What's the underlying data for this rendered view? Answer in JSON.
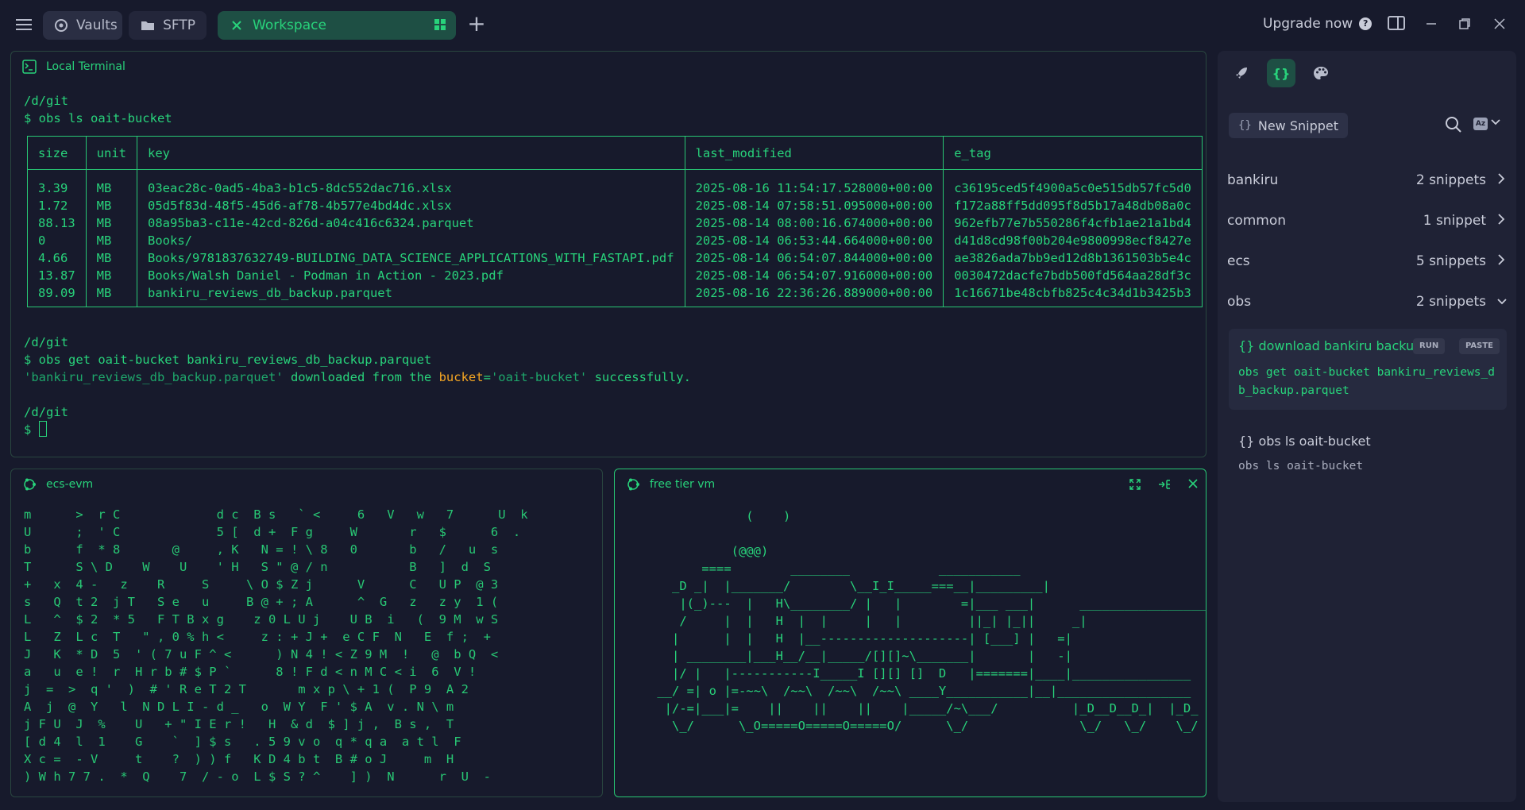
{
  "topbar": {
    "tabs": [
      {
        "label": "Vaults",
        "icon": "vault-icon"
      },
      {
        "label": "SFTP",
        "icon": "folder-icon"
      },
      {
        "label": "Workspace",
        "icon": "workspace-icon"
      }
    ],
    "upgrade_label": "Upgrade now",
    "accent": "#28d37b"
  },
  "main_terminal": {
    "title": "Local Terminal",
    "lines": {
      "cwd1": "/d/git",
      "cmd1": "$ obs ls oait-bucket",
      "cwd2": "/d/git",
      "cmd2": "$ obs get oait-bucket bankiru_reviews_db_backup.parquet",
      "out_q1": "'bankiru_reviews_db_backup.parquet'",
      "out_mid": " downloaded from the ",
      "out_bucket": "bucket",
      "out_eq": "=",
      "out_q2": "'oait-bucket'",
      "out_end": " successfully.",
      "cwd3": "/d/git",
      "prompt": "$ "
    },
    "table": {
      "headers": [
        "size",
        "unit",
        "key",
        "last_modified",
        "e_tag"
      ],
      "rows": [
        [
          "3.39",
          "MB",
          "03eac28c-0ad5-4ba3-b1c5-8dc552dac716.xlsx",
          "2025-08-16 11:54:17.528000+00:00",
          "c36195ced5f4900a5c0e515db57fc5d0"
        ],
        [
          "1.72",
          "MB",
          "05d5f83d-48f5-45d6-af78-4b577e4bd4dc.xlsx",
          "2025-08-14 07:58:51.095000+00:00",
          "f172a88ff5dd095f8d5b17a48db08a0c"
        ],
        [
          "88.13",
          "MB",
          "08a95ba3-c11e-42cd-826d-a04c416c6324.parquet",
          "2025-08-14 08:00:16.674000+00:00",
          "962efb77e7b550286f4cfb1ae21a1bd4"
        ],
        [
          "0",
          "MB",
          "Books/",
          "2025-08-14 06:53:44.664000+00:00",
          "d41d8cd98f00b204e9800998ecf8427e"
        ],
        [
          "4.66",
          "MB",
          "Books/9781837632749-BUILDING_DATA_SCIENCE_APPLICATIONS_WITH_FASTAPI.pdf",
          "2025-08-14 06:54:07.844000+00:00",
          "ae3826ada7bb9ed12d8b1361503b5e4c"
        ],
        [
          "13.87",
          "MB",
          "Books/Walsh Daniel - Podman in Action - 2023.pdf",
          "2025-08-14 06:54:07.916000+00:00",
          "0030472dacfe7bdb500fd564aa28df3c"
        ],
        [
          "89.09",
          "MB",
          "bankiru_reviews_db_backup.parquet",
          "2025-08-16 22:36:26.889000+00:00",
          "1c16671be48cbfb825c4c34d1b3425b3"
        ]
      ]
    }
  },
  "ecs_terminal": {
    "title": "ecs-evm",
    "rows": [
      "m      >  r C             d c  B s   ` <     6   V   w   7      U  k",
      "U      ;  ' C             5 [  d +  F g     W       r   $      6  .",
      "b      f  * 8       @     , K   N = ! \\ 8   0       b   /   u  s",
      "T      S \\ D    W    U    ' H   S \" @ / n           B   ]  d  S",
      "+   x  4 -   z    R     S     \\ O $ Z j      V      C   U P  @ 3",
      "s   Q  t 2  j T   S e   u     B @ + ; A      ^  G   z   z y  1 (",
      "L   ^  $ 2  * 5   F T B x g    z 0 L U j    U B  i   (  9 M  w S",
      "L   Z  L c  T   \" , 0 % h <     z : + J +  e C F  N   E  f ;  +",
      "J   K  * D  5  ' ( 7 u F ^ <      ) N 4 ! < Z 9 M  !   @  b Q  <",
      "a   u  e !  r  H r b # $ P `      8 ! F d < n M C < i  6  V !",
      "j  =  >  q '  )  # ' R e T 2 T       m x p \\ + 1 (  P 9  A 2",
      "A  j  @  Y   l  N D L I - d _   o  W Y  F ' $ A  v . N \\ m",
      "j F U  J  %    U   + \" I E r !   H  & d  $ ] j ,  B s ,  T",
      "[ d 4  l  1    G    `  ] $ s   . 5 9 v o  q * q a  a t l  F",
      "X c =  - V     t    ?  ) ) f   K D 4 b t  B # o J     m  H",
      ") W h 7 7 .  *  Q    7  / - o  L $ S ? ^    ] )  N      r  U  -"
    ]
  },
  "free_terminal": {
    "title": "free tier vm",
    "ascii": "                (    )\n\n              (@@@)\n          ====        ________            ___________\n      _D _|  |_______/        \\__I_I_____===__|_________|\n       |(_)---  |   H\\________/ |   |        =|___ ___|      _________________\n       /     |  |   H  |  |     |   |         ||_| |_||     _|\n      |      |  |   H  |__--------------------| [___] |   =|\n      | ________|___H__/__|_____/[][]~\\_______|       |   -|\n      |/ |   |-----------I_____I [][] []  D   |=======|____|________________\n    __/ =| o |=-~~\\  /~~\\  /~~\\  /~~\\ ____Y___________|__|__________________\n     |/-=|___|=    ||    ||    ||    |_____/~\\___/          |_D__D__D_|  |_D_\n      \\_/      \\_O=====O=====O=====O/      \\_/               \\_/   \\_/    \\_/"
  },
  "sidebar": {
    "new_snippet_label": "New Snippet",
    "groups": [
      {
        "name": "bankiru",
        "count": "2 snippets"
      },
      {
        "name": "common",
        "count": "1 snippet"
      },
      {
        "name": "ecs",
        "count": "5 snippets"
      },
      {
        "name": "obs",
        "count": "2 snippets"
      }
    ],
    "snippets": [
      {
        "title": "{} download bankiru backup",
        "body": "obs get oait-bucket bankiru_reviews_db_backup.parquet",
        "run": "RUN",
        "paste": "PASTE"
      },
      {
        "title": "{} obs ls oait-bucket",
        "body": "obs ls oait-bucket"
      }
    ]
  }
}
